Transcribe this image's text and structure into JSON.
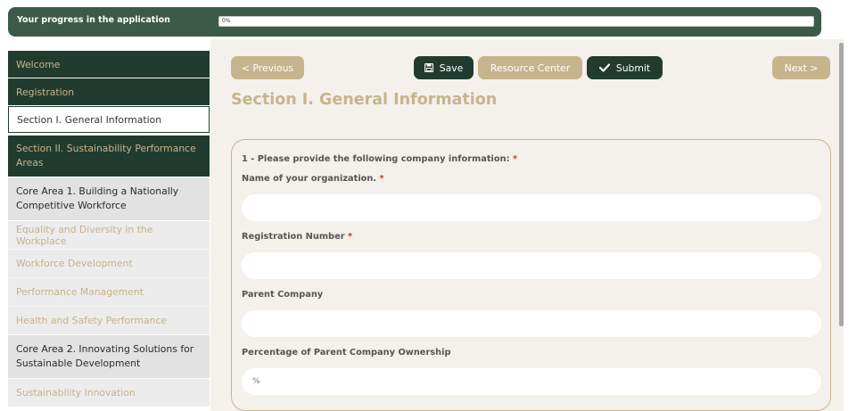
{
  "progress": {
    "label": "Your progress in the application",
    "percent_text": "0%",
    "value": 0
  },
  "nav": {
    "previous_label": "< Previous",
    "save_label": "Save",
    "resource_center_label": "Resource Center",
    "submit_label": "Submit",
    "next_label": "Next >"
  },
  "sidebar": {
    "items": [
      {
        "label": "Welcome"
      },
      {
        "label": "Registration"
      },
      {
        "label": "Section I. General Information"
      },
      {
        "label": "Section II. Sustainability Performance Areas"
      },
      {
        "label": "Core Area 1. Building a Nationally Competitive Workforce"
      },
      {
        "label": "Equality and Diversity in the Workplace"
      },
      {
        "label": "Workforce Development"
      },
      {
        "label": "Performance Management"
      },
      {
        "label": "Health and Safety Performance"
      },
      {
        "label": "Core Area 2. Innovating Solutions for Sustainable Development"
      },
      {
        "label": "Sustainability Innovation"
      }
    ]
  },
  "main": {
    "section_title": "Section I. General Information",
    "question_heading": "1 - Please provide the following company information:",
    "required_mark": "*",
    "fields": [
      {
        "label": "Name of your organization.",
        "required": true,
        "value": "",
        "placeholder": ""
      },
      {
        "label": "Registration Number",
        "required": true,
        "value": "",
        "placeholder": ""
      },
      {
        "label": "Parent Company",
        "required": false,
        "value": "",
        "placeholder": ""
      },
      {
        "label": "Percentage of Parent Company Ownership",
        "required": false,
        "value": "",
        "placeholder": "%"
      }
    ]
  },
  "colors": {
    "dark_green": "#213c2e",
    "header_green": "#3c5a4a",
    "tan": "#c8b48c",
    "background": "#f4f1ec",
    "required": "#c0392b"
  },
  "icons": {
    "save": "floppy-disk-icon",
    "submit": "checkmark-icon"
  }
}
